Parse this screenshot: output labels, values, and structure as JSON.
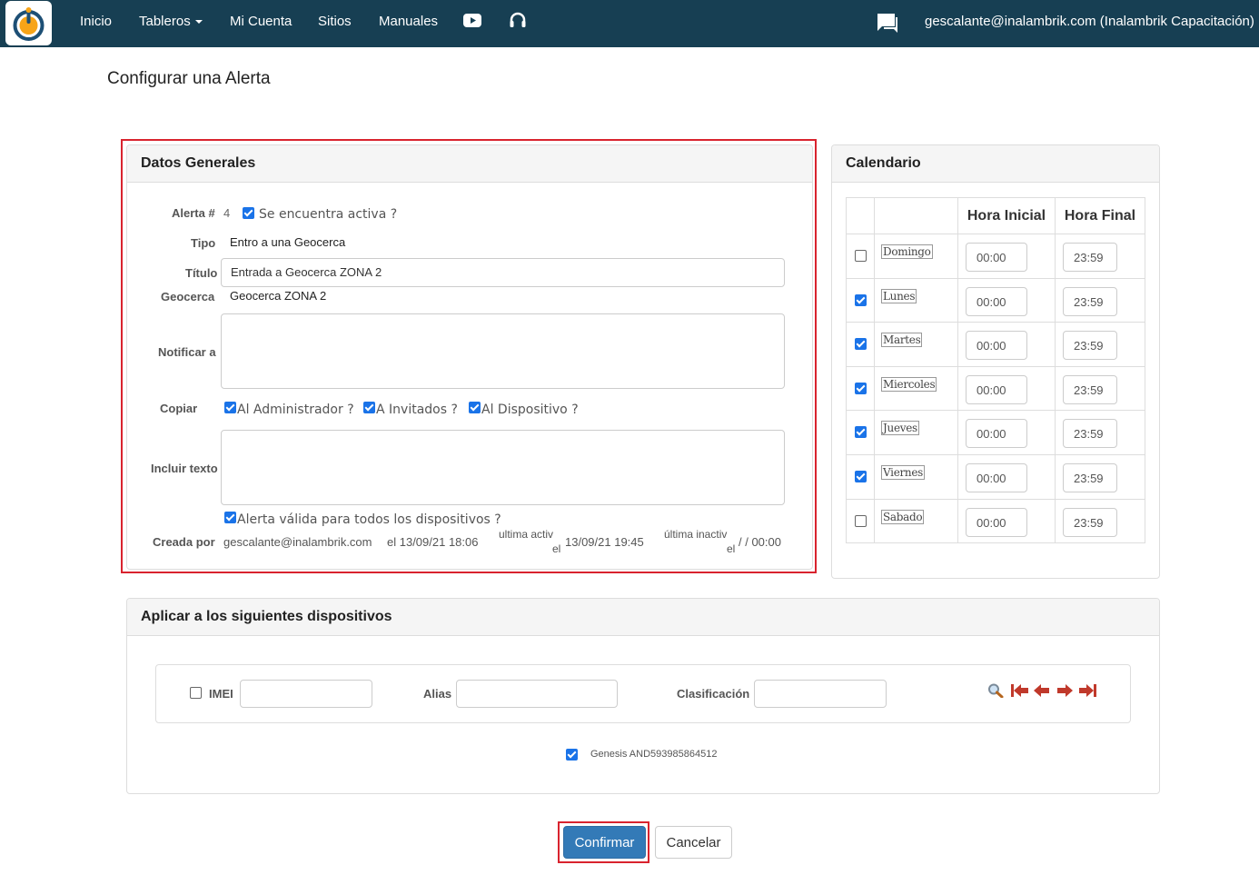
{
  "nav": {
    "items": [
      "Inicio",
      "Tableros",
      "Mi Cuenta",
      "Sitios",
      "Manuales"
    ],
    "icons": [
      "youtube-icon",
      "headset-icon",
      "chat-icon"
    ],
    "user": "gescalante@inalambrik.com (Inalambrik Capacitación)"
  },
  "page_title": "Configurar una Alerta",
  "general": {
    "heading": "Datos Generales",
    "alerta_label": "Alerta #",
    "alerta_num": "4",
    "active_label": "Se encuentra activa ?",
    "tipo_label": "Tipo",
    "tipo": "Entro a una Geocerca",
    "titulo_label": "Título",
    "titulo": "Entrada a Geocerca ZONA 2",
    "geocerca_label": "Geocerca",
    "geocerca": "Geocerca ZONA 2",
    "notificar_label": "Notificar a",
    "copiar_label": "Copiar",
    "copiar_admin": "Al Administrador ?",
    "copiar_invitados": "A Invitados ?",
    "copiar_dispositivo": "Al Dispositivo ?",
    "incluir_label": "Incluir texto",
    "valida_label": "Alerta válida para todos los dispositivos ?",
    "creada_label": "Creada por",
    "creada_por": "gescalante@inalambrik.com",
    "creada_fecha": "el 13/09/21 18:06",
    "ultima_activ_label": "ultima activ",
    "ultima_activ_el": "el",
    "ultima_activ": "13/09/21 19:45",
    "ultima_inactiv_label": "última inactiv",
    "ultima_inactiv_el": "el",
    "ultima_inactiv": "/ / 00:00"
  },
  "calendar": {
    "heading": "Calendario",
    "col_start": "Hora Inicial",
    "col_end": "Hora Final",
    "days": [
      {
        "name": "Domingo",
        "checked": false,
        "start": "00:00",
        "end": "23:59"
      },
      {
        "name": "Lunes",
        "checked": true,
        "start": "00:00",
        "end": "23:59"
      },
      {
        "name": "Martes",
        "checked": true,
        "start": "00:00",
        "end": "23:59"
      },
      {
        "name": "Miercoles",
        "checked": true,
        "start": "00:00",
        "end": "23:59"
      },
      {
        "name": "Jueves",
        "checked": true,
        "start": "00:00",
        "end": "23:59"
      },
      {
        "name": "Viernes",
        "checked": true,
        "start": "00:00",
        "end": "23:59"
      },
      {
        "name": "Sabado",
        "checked": false,
        "start": "00:00",
        "end": "23:59"
      }
    ]
  },
  "devices": {
    "heading": "Aplicar a los siguientes dispositivos",
    "imei_label": "IMEI",
    "alias_label": "Alias",
    "clasif_label": "Clasificación",
    "device": "Genesis AND593985864512"
  },
  "buttons": {
    "confirm": "Confirmar",
    "cancel": "Cancelar"
  },
  "colors": {
    "navbar": "#173f53",
    "highlight": "#d9232e",
    "primary": "#337ab7",
    "checkbox": "#1a73e8",
    "pager_icons": "#c0392b"
  }
}
